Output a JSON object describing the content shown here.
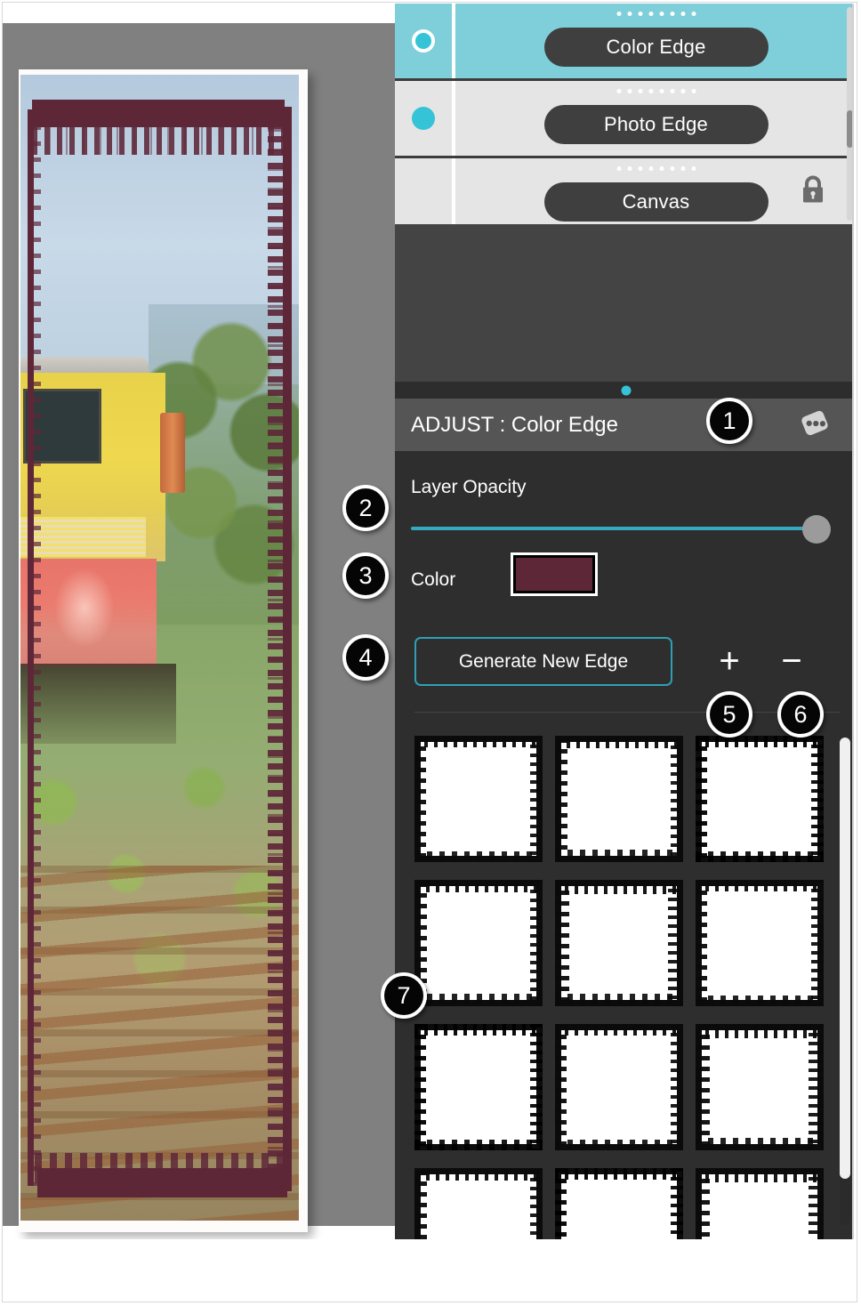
{
  "app": {
    "name": "photo-edge-editor"
  },
  "layers_panel": {
    "name": "Layers",
    "rows": [
      {
        "label": "Color Edge",
        "selected": true,
        "visible": true,
        "locked": false,
        "visibility_icon": "visibility-dot-ringed-icon",
        "grip_icon": "drag-handle-dots-icon"
      },
      {
        "label": "Photo Edge",
        "selected": false,
        "visible": true,
        "locked": false,
        "visibility_icon": "visibility-dot-icon",
        "grip_icon": "drag-handle-dots-icon"
      },
      {
        "label": "Canvas",
        "selected": false,
        "visible": false,
        "locked": true,
        "visibility_icon": "visibility-dot-empty-icon",
        "grip_icon": "drag-handle-dots-icon",
        "lock_icon": "lock-closed-icon"
      }
    ]
  },
  "divider": {
    "handle_icon": "panel-resize-dot-icon"
  },
  "adjust_panel": {
    "title": "ADJUST : Color Edge",
    "randomize_icon": "dice-icon",
    "opacity": {
      "label": "Layer Opacity",
      "value": 100,
      "min": 0,
      "max": 100
    },
    "color": {
      "label": "Color",
      "swatch_hex": "#5e2738"
    },
    "generate_button": "Generate New Edge",
    "add_button": "+",
    "remove_button": "−",
    "presets": {
      "count_visible": 12,
      "rows": 4,
      "columns": 3,
      "item_name": "edge-preset-thumbnail"
    }
  },
  "colors": {
    "accent_teal": "#35c3d8",
    "selected_layer_bg": "#7ecfd9",
    "panel_bg": "#2e2e2e",
    "header_bg": "#555555",
    "layer_row_bg": "#e5e5e5",
    "pill_bg": "#3f3f3f",
    "workspace_bg": "#808080",
    "edge_color": "#5e2738",
    "slider_track": "#35a9c0",
    "slider_thumb": "#9b9b9b",
    "generate_border": "#2f9fb5"
  },
  "callouts": [
    {
      "number": "1",
      "target": "randomize-dice-icon"
    },
    {
      "number": "2",
      "target": "layer-opacity-slider"
    },
    {
      "number": "3",
      "target": "color-swatch"
    },
    {
      "number": "4",
      "target": "generate-new-edge-button"
    },
    {
      "number": "5",
      "target": "add-preset-button"
    },
    {
      "number": "6",
      "target": "remove-preset-button"
    },
    {
      "number": "7",
      "target": "edge-presets-grid"
    }
  ],
  "canvas": {
    "name": "photo-canvas",
    "artwork_description": "photo-with-maroon-grunge-edge"
  }
}
